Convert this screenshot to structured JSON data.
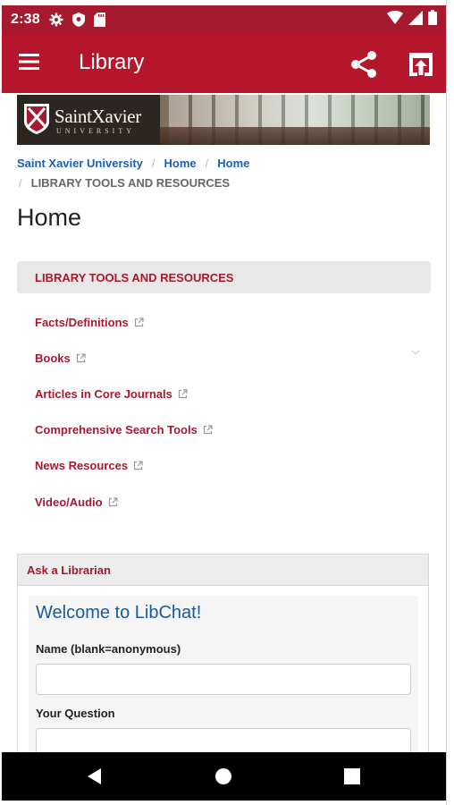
{
  "status_bar": {
    "time": "2:38",
    "icons": [
      "gear-icon",
      "shield-icon",
      "sd-card-icon",
      "wifi-icon",
      "signal-icon",
      "battery-icon"
    ]
  },
  "app_bar": {
    "title": "Library",
    "icons": [
      "menu-icon",
      "share-icon",
      "open-in-browser-icon"
    ],
    "color": "#b5162b"
  },
  "banner": {
    "logo_text": "SaintXavier",
    "logo_subtext": "UNIVERSITY"
  },
  "breadcrumb": {
    "items": [
      "Saint Xavier University",
      "Home",
      "Home"
    ],
    "current": "LIBRARY TOOLS AND RESOURCES"
  },
  "page": {
    "title": "Home"
  },
  "side_nav": {
    "heading": "LIBRARY TOOLS AND RESOURCES",
    "items": [
      {
        "label": "Facts/Definitions"
      },
      {
        "label": "Books"
      },
      {
        "label": "Articles in Core Journals"
      },
      {
        "label": "Comprehensive Search Tools"
      },
      {
        "label": "News Resources"
      },
      {
        "label": "Video/Audio"
      }
    ]
  },
  "ask_librarian": {
    "heading": "Ask a Librarian",
    "welcome": "Welcome to LibChat!",
    "name_label": "Name (blank=anonymous)",
    "question_label": "Your Question",
    "name_value": "",
    "question_value": ""
  },
  "nav_bar": {
    "icons": [
      "back-icon",
      "home-icon",
      "recents-icon"
    ]
  },
  "colors": {
    "brand_red": "#a6192e",
    "link_blue": "#1d5fb4",
    "chat_blue": "#1a5a96"
  }
}
